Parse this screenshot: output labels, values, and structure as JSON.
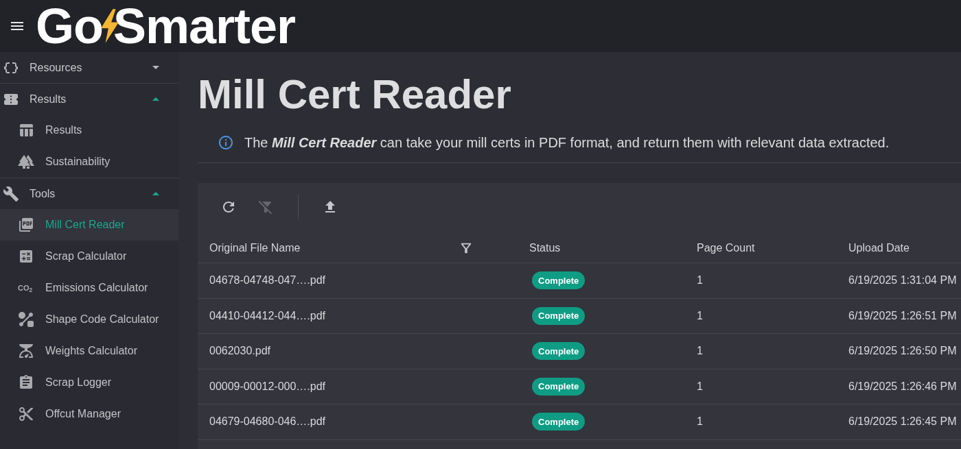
{
  "header": {
    "logo": {
      "parts": [
        "Go",
        "Smarter"
      ]
    }
  },
  "sidebar": {
    "groups": [
      {
        "label": "Resources",
        "expanded": false
      },
      {
        "label": "Results",
        "expanded": true,
        "children": [
          {
            "label": "Results",
            "selected": false
          },
          {
            "label": "Sustainability",
            "selected": false
          }
        ]
      },
      {
        "label": "Tools",
        "expanded": true,
        "children": [
          {
            "label": "Mill Cert Reader",
            "selected": true
          },
          {
            "label": "Scrap Calculator",
            "selected": false
          },
          {
            "label": "Emissions Calculator",
            "selected": false,
            "icon_text": "CO$_{2}$"
          },
          {
            "label": "Shape Code Calculator",
            "selected": false
          },
          {
            "label": "Weights Calculator",
            "selected": false
          },
          {
            "label": "Scrap Logger",
            "selected": false
          },
          {
            "label": "Offcut Manager",
            "selected": false
          }
        ]
      }
    ]
  },
  "page": {
    "title": "Mill Cert Reader",
    "info": "The **Mill Cert Reader** can take your mill certs in PDF format, and return them with relevant data extracted.",
    "toolbar": {
      "buttons": [
        {
          "disabled": false
        },
        {
          "disabled": true
        },
        {
          "disabled": false
        }
      ]
    },
    "table": {
      "columns": [
        {
          "label": "Original File Name",
          "filterable": true
        },
        {
          "label": "Status"
        },
        {
          "label": "Page Count"
        },
        {
          "label": "Upload Date"
        }
      ],
      "rows": [
        {
          "file_name": "04678-04748-047….pdf",
          "status": "Complete",
          "page_count": "1",
          "upload_date": "6/19/2025 1:31:04 PM"
        },
        {
          "file_name": "04410-04412-044….pdf",
          "status": "Complete",
          "page_count": "1",
          "upload_date": "6/19/2025 1:26:51 PM"
        },
        {
          "file_name": "0062030.pdf",
          "status": "Complete",
          "page_count": "1",
          "upload_date": "6/19/2025 1:26:50 PM"
        },
        {
          "file_name": "00009-00012-000….pdf",
          "status": "Complete",
          "page_count": "1",
          "upload_date": "6/19/2025 1:26:46 PM"
        },
        {
          "file_name": "04679-04680-046….pdf",
          "status": "Complete",
          "page_count": "1",
          "upload_date": "6/19/2025 1:26:45 PM"
        }
      ]
    }
  }
}
